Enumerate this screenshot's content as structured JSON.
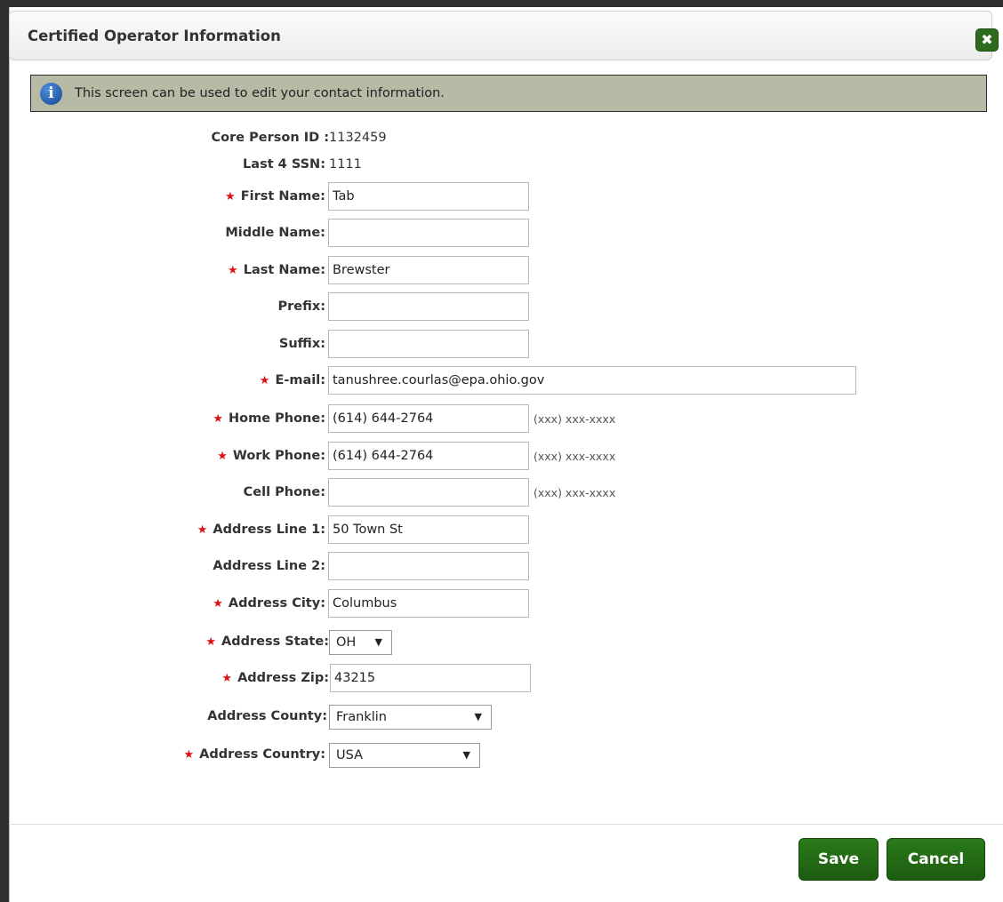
{
  "dialog": {
    "title": "Certified Operator Information",
    "close_glyph": "✖",
    "info_text": "This screen can be used to edit your contact information.",
    "info_glyph": "i"
  },
  "form": {
    "core_person_id": {
      "label": "Core Person ID :",
      "value": "1132459"
    },
    "last4_ssn": {
      "label": "Last 4 SSN:",
      "value": "1111"
    },
    "first_name": {
      "label": "First Name:",
      "value": "Tab",
      "required": true
    },
    "middle_name": {
      "label": "Middle Name:",
      "value": ""
    },
    "last_name": {
      "label": "Last Name:",
      "value": "Brewster",
      "required": true
    },
    "prefix": {
      "label": "Prefix:",
      "value": ""
    },
    "suffix": {
      "label": "Suffix:",
      "value": ""
    },
    "email": {
      "label": "E-mail:",
      "value": "tanushree.courlas@epa.ohio.gov",
      "required": true
    },
    "home_phone": {
      "label": "Home Phone:",
      "value": "(614) 644-2764",
      "hint": "(xxx) xxx-xxxx",
      "required": true
    },
    "work_phone": {
      "label": "Work Phone:",
      "value": "(614) 644-2764",
      "hint": "(xxx) xxx-xxxx",
      "required": true
    },
    "cell_phone": {
      "label": "Cell Phone:",
      "value": "",
      "hint": "(xxx) xxx-xxxx"
    },
    "address_line1": {
      "label": "Address Line 1:",
      "value": "50 Town St",
      "required": true
    },
    "address_line2": {
      "label": "Address Line 2:",
      "value": ""
    },
    "address_city": {
      "label": "Address City:",
      "value": "Columbus",
      "required": true
    },
    "address_state": {
      "label": "Address State:",
      "value": "OH",
      "required": true
    },
    "address_zip": {
      "label": "Address Zip:",
      "value": "43215",
      "required": true
    },
    "address_county": {
      "label": "Address County:",
      "value": "Franklin"
    },
    "address_country": {
      "label": "Address Country:",
      "value": "USA",
      "required": true
    },
    "required_marker": "★",
    "dropdown_arrow": "▼"
  },
  "buttons": {
    "save": "Save",
    "cancel": "Cancel"
  },
  "colors": {
    "button_green": "#1f6514",
    "info_bar": "#b7bba6",
    "required": "#dd1111"
  }
}
